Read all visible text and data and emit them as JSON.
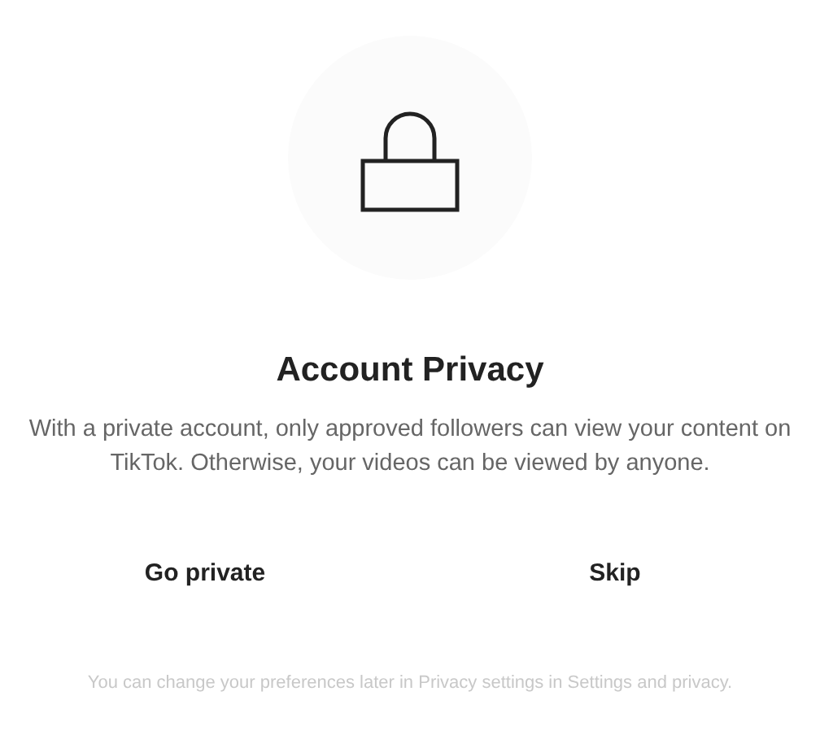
{
  "title": "Account Privacy",
  "description": "With a private account, only approved followers can view your content on TikTok. Otherwise, your videos can be viewed by anyone.",
  "buttons": [
    {
      "label": "Go private"
    },
    {
      "label": "Skip"
    }
  ],
  "footnote": "You can change your preferences later in Privacy settings in Settings and privacy."
}
